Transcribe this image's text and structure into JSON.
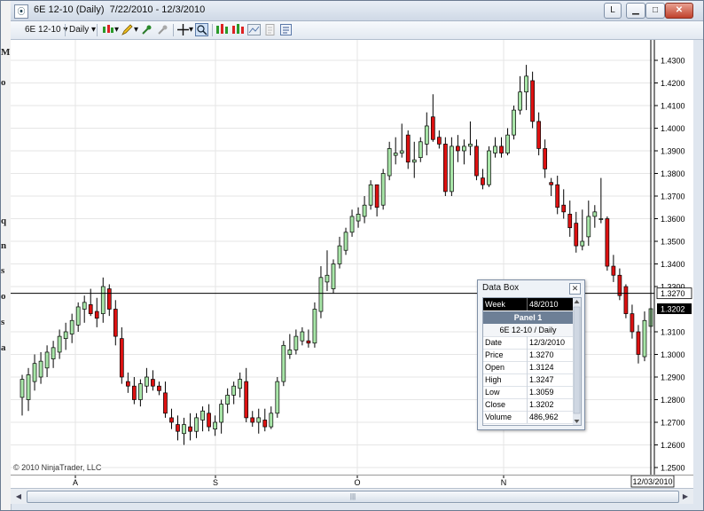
{
  "window": {
    "title": "6E 12-10 (Daily)  7/22/2010 - 12/3/2010",
    "link_button": "L"
  },
  "toolbar": {
    "instrument": "6E 12-10",
    "interval": "Daily"
  },
  "behind_window_letters": [
    "M",
    "o",
    "q",
    "n",
    "s",
    "o",
    "s",
    "a"
  ],
  "copyright": "© 2010 NinjaTrader, LLC",
  "price_axis": {
    "labels": [
      "1.4300",
      "1.4200",
      "1.4100",
      "1.4000",
      "1.3900",
      "1.3800",
      "1.3700",
      "1.3600",
      "1.3500",
      "1.3400",
      "1.3300",
      "1.3100",
      "1.3000",
      "1.2900",
      "1.2800",
      "1.2700",
      "1.2600",
      "1.2500"
    ],
    "crosshair_label": "1.3270",
    "last_price_label": "1.3202"
  },
  "time_axis": {
    "labels": [
      "A",
      "S",
      "O",
      "N"
    ],
    "crosshair_date": "12/03/2010"
  },
  "data_box": {
    "title": "Data Box",
    "week_label": "Week",
    "week_value": "48/2010",
    "panel": "Panel 1",
    "instrument": "6E 12-10 / Daily",
    "rows": [
      {
        "label": "Date",
        "value": "12/3/2010"
      },
      {
        "label": "Price",
        "value": "1.3270"
      },
      {
        "label": "Open",
        "value": "1.3124"
      },
      {
        "label": "High",
        "value": "1.3247"
      },
      {
        "label": "Low",
        "value": "1.3059"
      },
      {
        "label": "Close",
        "value": "1.3202"
      },
      {
        "label": "Volume",
        "value": "486,962"
      }
    ]
  },
  "colors": {
    "up_candle": "#a8e6a8",
    "down_candle": "#dd1111",
    "crosshair": "#000000",
    "grid": "#e6e6e6"
  },
  "chart_data": {
    "type": "candlestick",
    "x_axis": "trading days 7/22/2010 - 12/3/2010",
    "ylim": [
      1.245,
      1.439
    ],
    "crosshair_price": 1.327,
    "candles": [
      {
        "o": 1.281,
        "h": 1.291,
        "l": 1.273,
        "c": 1.289
      },
      {
        "o": 1.28,
        "h": 1.294,
        "l": 1.275,
        "c": 1.291
      },
      {
        "o": 1.288,
        "h": 1.3,
        "l": 1.284,
        "c": 1.296
      },
      {
        "o": 1.29,
        "h": 1.301,
        "l": 1.287,
        "c": 1.297
      },
      {
        "o": 1.294,
        "h": 1.304,
        "l": 1.29,
        "c": 1.301
      },
      {
        "o": 1.298,
        "h": 1.306,
        "l": 1.294,
        "c": 1.303
      },
      {
        "o": 1.301,
        "h": 1.311,
        "l": 1.298,
        "c": 1.308
      },
      {
        "o": 1.307,
        "h": 1.314,
        "l": 1.302,
        "c": 1.31
      },
      {
        "o": 1.309,
        "h": 1.318,
        "l": 1.305,
        "c": 1.315
      },
      {
        "o": 1.313,
        "h": 1.323,
        "l": 1.31,
        "c": 1.321
      },
      {
        "o": 1.32,
        "h": 1.326,
        "l": 1.314,
        "c": 1.323
      },
      {
        "o": 1.322,
        "h": 1.329,
        "l": 1.317,
        "c": 1.318
      },
      {
        "o": 1.319,
        "h": 1.325,
        "l": 1.312,
        "c": 1.316
      },
      {
        "o": 1.318,
        "h": 1.334,
        "l": 1.314,
        "c": 1.33
      },
      {
        "o": 1.329,
        "h": 1.331,
        "l": 1.317,
        "c": 1.32
      },
      {
        "o": 1.32,
        "h": 1.324,
        "l": 1.304,
        "c": 1.308
      },
      {
        "o": 1.307,
        "h": 1.312,
        "l": 1.287,
        "c": 1.29
      },
      {
        "o": 1.288,
        "h": 1.292,
        "l": 1.283,
        "c": 1.286
      },
      {
        "o": 1.286,
        "h": 1.29,
        "l": 1.278,
        "c": 1.28
      },
      {
        "o": 1.28,
        "h": 1.289,
        "l": 1.277,
        "c": 1.287
      },
      {
        "o": 1.286,
        "h": 1.294,
        "l": 1.283,
        "c": 1.29
      },
      {
        "o": 1.289,
        "h": 1.293,
        "l": 1.284,
        "c": 1.286
      },
      {
        "o": 1.286,
        "h": 1.288,
        "l": 1.282,
        "c": 1.284
      },
      {
        "o": 1.283,
        "h": 1.288,
        "l": 1.272,
        "c": 1.274
      },
      {
        "o": 1.272,
        "h": 1.276,
        "l": 1.267,
        "c": 1.27
      },
      {
        "o": 1.269,
        "h": 1.273,
        "l": 1.262,
        "c": 1.266
      },
      {
        "o": 1.265,
        "h": 1.272,
        "l": 1.26,
        "c": 1.269
      },
      {
        "o": 1.268,
        "h": 1.274,
        "l": 1.262,
        "c": 1.266
      },
      {
        "o": 1.266,
        "h": 1.274,
        "l": 1.263,
        "c": 1.272
      },
      {
        "o": 1.271,
        "h": 1.277,
        "l": 1.266,
        "c": 1.275
      },
      {
        "o": 1.274,
        "h": 1.278,
        "l": 1.266,
        "c": 1.268
      },
      {
        "o": 1.267,
        "h": 1.273,
        "l": 1.264,
        "c": 1.27
      },
      {
        "o": 1.27,
        "h": 1.28,
        "l": 1.265,
        "c": 1.278
      },
      {
        "o": 1.278,
        "h": 1.285,
        "l": 1.274,
        "c": 1.282
      },
      {
        "o": 1.282,
        "h": 1.288,
        "l": 1.278,
        "c": 1.286
      },
      {
        "o": 1.285,
        "h": 1.292,
        "l": 1.281,
        "c": 1.289
      },
      {
        "o": 1.288,
        "h": 1.294,
        "l": 1.27,
        "c": 1.272
      },
      {
        "o": 1.272,
        "h": 1.275,
        "l": 1.268,
        "c": 1.27
      },
      {
        "o": 1.27,
        "h": 1.276,
        "l": 1.265,
        "c": 1.272
      },
      {
        "o": 1.271,
        "h": 1.276,
        "l": 1.266,
        "c": 1.268
      },
      {
        "o": 1.268,
        "h": 1.277,
        "l": 1.267,
        "c": 1.274
      },
      {
        "o": 1.274,
        "h": 1.29,
        "l": 1.272,
        "c": 1.288
      },
      {
        "o": 1.288,
        "h": 1.306,
        "l": 1.286,
        "c": 1.304
      },
      {
        "o": 1.3,
        "h": 1.309,
        "l": 1.298,
        "c": 1.302
      },
      {
        "o": 1.302,
        "h": 1.311,
        "l": 1.3,
        "c": 1.308
      },
      {
        "o": 1.306,
        "h": 1.312,
        "l": 1.304,
        "c": 1.31
      },
      {
        "o": 1.306,
        "h": 1.311,
        "l": 1.303,
        "c": 1.305
      },
      {
        "o": 1.305,
        "h": 1.323,
        "l": 1.303,
        "c": 1.32
      },
      {
        "o": 1.319,
        "h": 1.339,
        "l": 1.316,
        "c": 1.334
      },
      {
        "o": 1.332,
        "h": 1.346,
        "l": 1.328,
        "c": 1.335
      },
      {
        "o": 1.329,
        "h": 1.342,
        "l": 1.327,
        "c": 1.34
      },
      {
        "o": 1.34,
        "h": 1.352,
        "l": 1.338,
        "c": 1.348
      },
      {
        "o": 1.346,
        "h": 1.356,
        "l": 1.344,
        "c": 1.354
      },
      {
        "o": 1.354,
        "h": 1.364,
        "l": 1.352,
        "c": 1.361
      },
      {
        "o": 1.359,
        "h": 1.365,
        "l": 1.356,
        "c": 1.362
      },
      {
        "o": 1.361,
        "h": 1.37,
        "l": 1.358,
        "c": 1.366
      },
      {
        "o": 1.366,
        "h": 1.377,
        "l": 1.364,
        "c": 1.375
      },
      {
        "o": 1.375,
        "h": 1.369,
        "l": 1.361,
        "c": 1.365
      },
      {
        "o": 1.366,
        "h": 1.382,
        "l": 1.364,
        "c": 1.38
      },
      {
        "o": 1.379,
        "h": 1.394,
        "l": 1.377,
        "c": 1.391
      },
      {
        "o": 1.388,
        "h": 1.396,
        "l": 1.384,
        "c": 1.389
      },
      {
        "o": 1.389,
        "h": 1.402,
        "l": 1.387,
        "c": 1.39
      },
      {
        "o": 1.397,
        "h": 1.399,
        "l": 1.382,
        "c": 1.385
      },
      {
        "o": 1.385,
        "h": 1.394,
        "l": 1.378,
        "c": 1.386
      },
      {
        "o": 1.387,
        "h": 1.396,
        "l": 1.385,
        "c": 1.394
      },
      {
        "o": 1.393,
        "h": 1.407,
        "l": 1.388,
        "c": 1.401
      },
      {
        "o": 1.405,
        "h": 1.415,
        "l": 1.394,
        "c": 1.395
      },
      {
        "o": 1.396,
        "h": 1.399,
        "l": 1.391,
        "c": 1.393
      },
      {
        "o": 1.393,
        "h": 1.396,
        "l": 1.37,
        "c": 1.372
      },
      {
        "o": 1.372,
        "h": 1.396,
        "l": 1.37,
        "c": 1.392
      },
      {
        "o": 1.392,
        "h": 1.397,
        "l": 1.385,
        "c": 1.39
      },
      {
        "o": 1.39,
        "h": 1.395,
        "l": 1.384,
        "c": 1.392
      },
      {
        "o": 1.392,
        "h": 1.403,
        "l": 1.388,
        "c": 1.393
      },
      {
        "o": 1.392,
        "h": 1.395,
        "l": 1.377,
        "c": 1.379
      },
      {
        "o": 1.378,
        "h": 1.382,
        "l": 1.373,
        "c": 1.375
      },
      {
        "o": 1.375,
        "h": 1.392,
        "l": 1.374,
        "c": 1.39
      },
      {
        "o": 1.389,
        "h": 1.396,
        "l": 1.387,
        "c": 1.392
      },
      {
        "o": 1.392,
        "h": 1.396,
        "l": 1.387,
        "c": 1.389
      },
      {
        "o": 1.389,
        "h": 1.4,
        "l": 1.388,
        "c": 1.397
      },
      {
        "o": 1.397,
        "h": 1.41,
        "l": 1.395,
        "c": 1.408
      },
      {
        "o": 1.408,
        "h": 1.423,
        "l": 1.406,
        "c": 1.416
      },
      {
        "o": 1.416,
        "h": 1.428,
        "l": 1.408,
        "c": 1.423
      },
      {
        "o": 1.421,
        "h": 1.425,
        "l": 1.4,
        "c": 1.403
      },
      {
        "o": 1.403,
        "h": 1.407,
        "l": 1.388,
        "c": 1.391
      },
      {
        "o": 1.391,
        "h": 1.395,
        "l": 1.378,
        "c": 1.382
      },
      {
        "o": 1.376,
        "h": 1.378,
        "l": 1.37,
        "c": 1.375
      },
      {
        "o": 1.375,
        "h": 1.379,
        "l": 1.362,
        "c": 1.365
      },
      {
        "o": 1.366,
        "h": 1.373,
        "l": 1.36,
        "c": 1.363
      },
      {
        "o": 1.362,
        "h": 1.368,
        "l": 1.352,
        "c": 1.356
      },
      {
        "o": 1.358,
        "h": 1.363,
        "l": 1.345,
        "c": 1.348
      },
      {
        "o": 1.348,
        "h": 1.364,
        "l": 1.346,
        "c": 1.35
      },
      {
        "o": 1.352,
        "h": 1.368,
        "l": 1.348,
        "c": 1.361
      },
      {
        "o": 1.361,
        "h": 1.366,
        "l": 1.356,
        "c": 1.363
      },
      {
        "o": 1.36,
        "h": 1.378,
        "l": 1.358,
        "c": 1.36
      },
      {
        "o": 1.36,
        "h": 1.361,
        "l": 1.337,
        "c": 1.339
      },
      {
        "o": 1.339,
        "h": 1.344,
        "l": 1.332,
        "c": 1.335
      },
      {
        "o": 1.335,
        "h": 1.338,
        "l": 1.324,
        "c": 1.326
      },
      {
        "o": 1.33,
        "h": 1.331,
        "l": 1.316,
        "c": 1.318
      },
      {
        "o": 1.318,
        "h": 1.322,
        "l": 1.307,
        "c": 1.31
      },
      {
        "o": 1.31,
        "h": 1.313,
        "l": 1.296,
        "c": 1.3
      },
      {
        "o": 1.299,
        "h": 1.319,
        "l": 1.297,
        "c": 1.315
      },
      {
        "o": 1.3124,
        "h": 1.3247,
        "l": 1.3059,
        "c": 1.3202
      }
    ]
  }
}
